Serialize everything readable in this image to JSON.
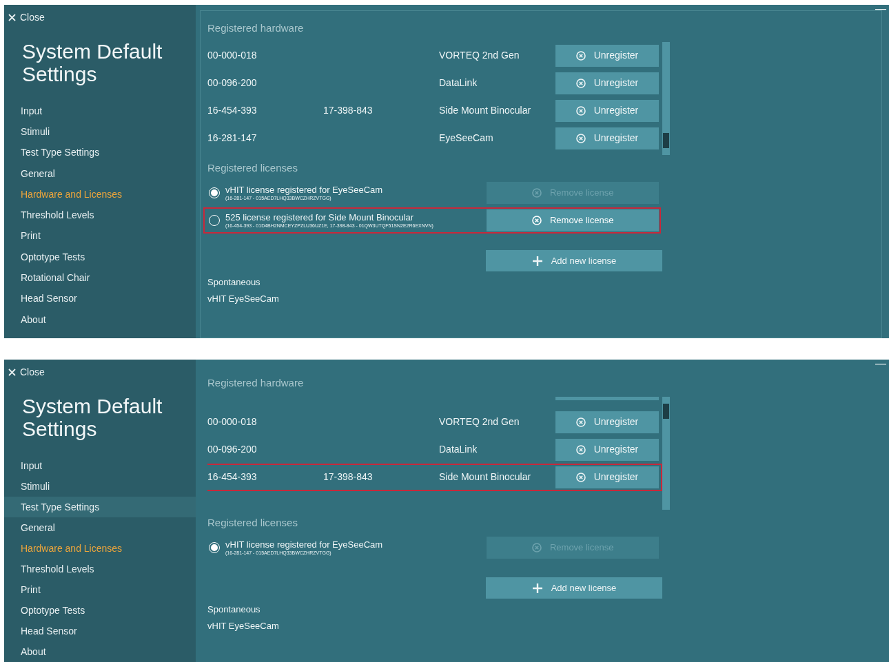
{
  "screens": [
    {
      "framed": true,
      "close": "Close",
      "minimize": "—",
      "title": "System Default Settings",
      "sidebar": [
        {
          "label": "Input",
          "selected": false,
          "hovered": false
        },
        {
          "label": "Stimuli",
          "selected": false,
          "hovered": false
        },
        {
          "label": "Test Type Settings",
          "selected": false,
          "hovered": false
        },
        {
          "label": "General",
          "selected": false,
          "hovered": false
        },
        {
          "label": "Hardware and Licenses",
          "selected": true,
          "hovered": false
        },
        {
          "label": "Threshold Levels",
          "selected": false,
          "hovered": false
        },
        {
          "label": "Print",
          "selected": false,
          "hovered": false
        },
        {
          "label": "Optotype Tests",
          "selected": false,
          "hovered": false
        },
        {
          "label": "Rotational Chair",
          "selected": false,
          "hovered": false
        },
        {
          "label": "Head Sensor",
          "selected": false,
          "hovered": false
        },
        {
          "label": "About",
          "selected": false,
          "hovered": false
        }
      ],
      "hardware": {
        "heading": "Registered hardware",
        "scrolled": false,
        "rows": [
          {
            "serial": "00-000-018",
            "serial_2": "",
            "device": "VORTEQ 2nd Gen",
            "button": "Unregister",
            "highlighted": false
          },
          {
            "serial": "00-096-200",
            "serial_2": "",
            "device": "DataLink",
            "button": "Unregister",
            "highlighted": false
          },
          {
            "serial": "16-454-393",
            "serial_2": "17-398-843",
            "device": "Side Mount Binocular",
            "button": "Unregister",
            "highlighted": false
          },
          {
            "serial": "16-281-147",
            "serial_2": "",
            "device": "EyeSeeCam",
            "button": "Unregister",
            "highlighted": false
          }
        ]
      },
      "licenses": {
        "heading": "Registered licenses",
        "items": [
          {
            "title": "vHIT license registered for EyeSeeCam",
            "detail": "(16-281-147 - 015AED7LHQ33BWCZHRZVTGG)",
            "selected": true,
            "highlighted": false,
            "button": "Remove license",
            "disabled": true
          },
          {
            "title": "525 license registered for Side Mount Binocular",
            "detail": "(16-454-393 - 01D4BH2NMCEYZPZLU36UZ1E, 17-398-843 - 01QW3UTQF51SN2E2R6EXNVN)",
            "selected": false,
            "highlighted": true,
            "button": "Remove license",
            "disabled": false
          }
        ],
        "add_button": "Add new license"
      },
      "footer": [
        "Spontaneous",
        "vHIT EyeSeeCam"
      ]
    },
    {
      "framed": false,
      "close": "Close",
      "minimize": "—",
      "title": "System Default Settings",
      "sidebar": [
        {
          "label": "Input",
          "selected": false,
          "hovered": false
        },
        {
          "label": "Stimuli",
          "selected": false,
          "hovered": false
        },
        {
          "label": "Test Type Settings",
          "selected": false,
          "hovered": true
        },
        {
          "label": "General",
          "selected": false,
          "hovered": false
        },
        {
          "label": "Hardware and Licenses",
          "selected": true,
          "hovered": false
        },
        {
          "label": "Threshold Levels",
          "selected": false,
          "hovered": false
        },
        {
          "label": "Print",
          "selected": false,
          "hovered": false
        },
        {
          "label": "Optotype Tests",
          "selected": false,
          "hovered": false
        },
        {
          "label": "Head Sensor",
          "selected": false,
          "hovered": false
        },
        {
          "label": "About",
          "selected": false,
          "hovered": false
        }
      ],
      "hardware": {
        "heading": "Registered hardware",
        "scrolled": true,
        "rows": [
          {
            "serial": "00-000-018",
            "serial_2": "",
            "device": "VORTEQ 2nd Gen",
            "button": "Unregister",
            "highlighted": false
          },
          {
            "serial": "00-096-200",
            "serial_2": "",
            "device": "DataLink",
            "button": "Unregister",
            "highlighted": false
          },
          {
            "serial": "16-454-393",
            "serial_2": "17-398-843",
            "device": "Side Mount Binocular",
            "button": "Unregister",
            "highlighted": true
          }
        ]
      },
      "licenses": {
        "heading": "Registered licenses",
        "items": [
          {
            "title": "vHIT license registered for EyeSeeCam",
            "detail": "(16-281-147 - 015AED7LHQ33BWCZHRZVTGG)",
            "selected": true,
            "highlighted": false,
            "button": "Remove license",
            "disabled": true
          }
        ],
        "add_button": "Add new license"
      },
      "footer": [
        "Spontaneous",
        "vHIT EyeSeeCam"
      ]
    }
  ]
}
